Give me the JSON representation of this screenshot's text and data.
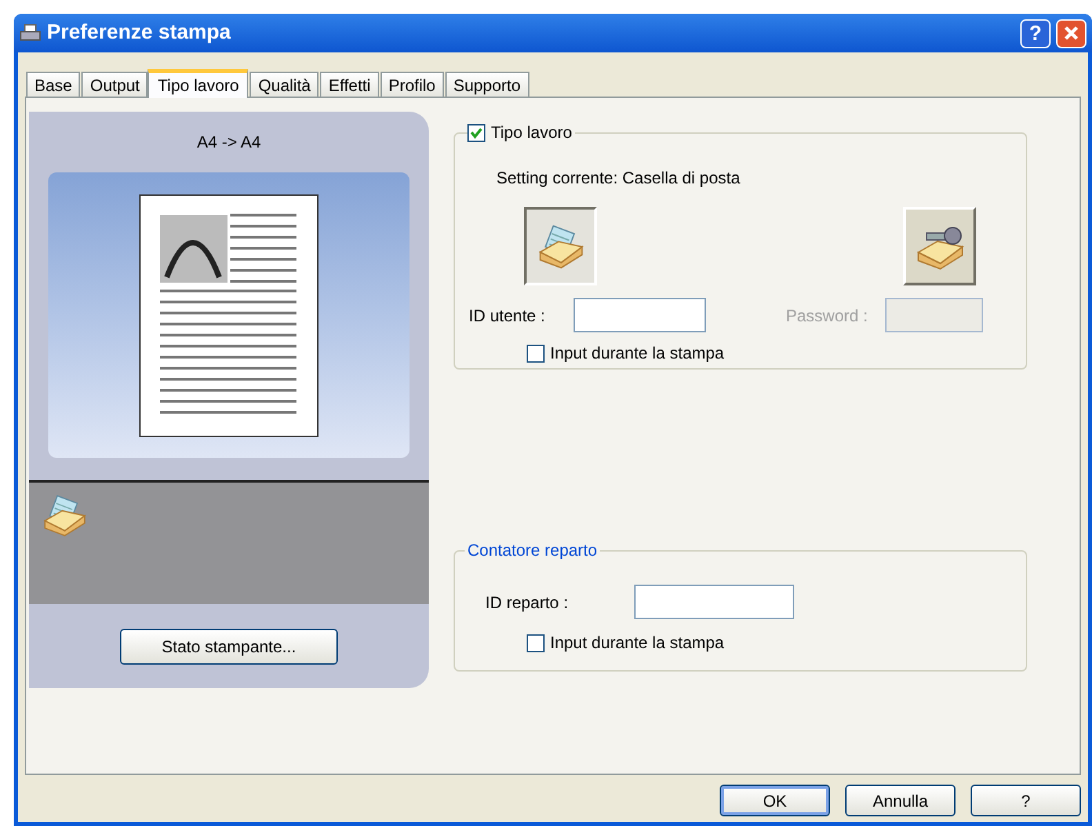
{
  "window": {
    "title": "Preferenze stampa",
    "help_button": "?"
  },
  "tabs": [
    {
      "label": "Base",
      "selected": false
    },
    {
      "label": "Output",
      "selected": false
    },
    {
      "label": "Tipo lavoro",
      "selected": true
    },
    {
      "label": "Qualità",
      "selected": false
    },
    {
      "label": "Effetti",
      "selected": false
    },
    {
      "label": "Profilo",
      "selected": false
    },
    {
      "label": "Supporto",
      "selected": false
    }
  ],
  "preview": {
    "paper_size": "A4 -> A4",
    "status_button": "Stato stampante..."
  },
  "job_type": {
    "label": "Tipo lavoro",
    "checked": true,
    "current_setting": "Setting corrente: Casella di posta",
    "modes": [
      {
        "kind": "mailbox",
        "selected": true
      },
      {
        "kind": "secure",
        "selected": false
      }
    ],
    "user_id": {
      "label": "ID utente :",
      "disabled": false
    },
    "password": {
      "label": "Password :",
      "disabled": true
    },
    "input_on_print": {
      "label": "Input durante la stampa",
      "checked": false
    }
  },
  "department": {
    "title": "Contatore reparto",
    "dept_id": {
      "label": "ID reparto :"
    },
    "input_on_print": {
      "label": "Input durante la stampa",
      "checked": false
    }
  },
  "buttons": [
    {
      "label": "OK",
      "default": true
    },
    {
      "label": "Annulla",
      "default": false
    },
    {
      "label": "?",
      "default": false
    }
  ]
}
